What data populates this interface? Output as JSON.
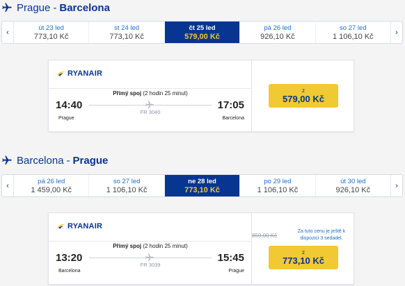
{
  "outbound": {
    "from": "Prague",
    "separator": "-",
    "to": "Barcelona",
    "dates": [
      {
        "label": "út 23 led",
        "price": "773,10 Kč"
      },
      {
        "label": "st 24 led",
        "price": "773,10 Kč"
      },
      {
        "label": "čt 25 led",
        "price": "579,00 Kč"
      },
      {
        "label": "pá 26 led",
        "price": "926,10 Kč"
      },
      {
        "label": "so 27 led",
        "price": "1 106,10 Kč"
      }
    ],
    "flight": {
      "airline": "RYANAIR",
      "type": "Přímý spoj",
      "duration": "(2 hodin 25 minut)",
      "number": "FR 3040",
      "dep_time": "14:40",
      "arr_time": "17:05",
      "dep_city": "Prague",
      "arr_city": "Barcelona",
      "price_from": "z",
      "price": "579,00 Kč"
    }
  },
  "return": {
    "from": "Barcelona",
    "separator": "-",
    "to": "Prague",
    "dates": [
      {
        "label": "pá 26 led",
        "price": "1 459,00 Kč"
      },
      {
        "label": "so 27 led",
        "price": "1 106,10 Kč"
      },
      {
        "label": "ne 28 led",
        "price": "773,10 Kč"
      },
      {
        "label": "po 29 led",
        "price": "1 106,10 Kč"
      },
      {
        "label": "út 30 led",
        "price": "926,10 Kč"
      }
    ],
    "flight": {
      "airline": "RYANAIR",
      "type": "Přímý spoj",
      "duration": "(2 hodin 25 minut)",
      "number": "FR 3039",
      "dep_time": "13:20",
      "arr_time": "15:45",
      "dep_city": "Barcelona",
      "arr_city": "Prague",
      "old_price": "859,00 Kč",
      "promo": "Za tuto cenu je ještě k dispozici 3 sedadel.",
      "price_from": "z",
      "price": "773,10 Kč"
    }
  },
  "nav": {
    "prev": "‹",
    "next": "›"
  },
  "colors": {
    "primary": "#073590",
    "accent": "#f1c933",
    "link": "#1a6fd0"
  },
  "icons": {
    "route": "plane-icon",
    "flight": "plane-icon",
    "logo": "ryanair-harp-icon"
  }
}
